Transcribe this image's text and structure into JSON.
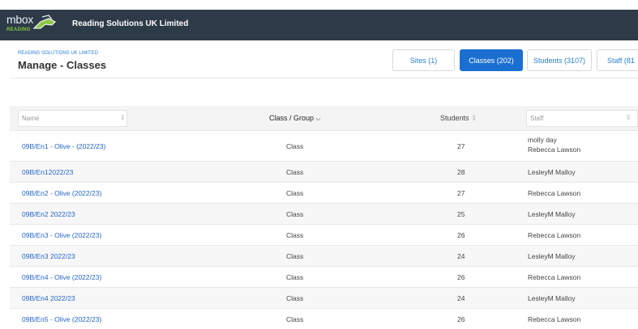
{
  "app": {
    "logo_text": "mbox",
    "logo_sub": "READING",
    "org_name": "Reading Solutions UK Limited"
  },
  "header": {
    "breadcrumb": "READING SOLUTIONS UK LIMITED",
    "title": "Manage - Classes"
  },
  "tabs": [
    {
      "label": "Sites (1)",
      "active": false
    },
    {
      "label": "Classes (202)",
      "active": true
    },
    {
      "label": "Students (3107)",
      "active": false
    },
    {
      "label": "Staff (81",
      "active": false
    }
  ],
  "table": {
    "columns": {
      "name_placeholder": "Name",
      "class_group_label": "Class / Group",
      "students_label": "Students",
      "staff_placeholder": "Staff"
    },
    "rows": [
      {
        "name": "09B/En1 - Olive - (2022/23)",
        "type": "Class",
        "students": "27",
        "staff": [
          "molly day",
          "Rebecca Lawson"
        ]
      },
      {
        "name": "09B/En12022/23",
        "type": "Class",
        "students": "28",
        "staff": [
          "LesleyM Malloy"
        ]
      },
      {
        "name": "09B/En2 - Olive (2022/23)",
        "type": "Class",
        "students": "27",
        "staff": [
          "Rebecca Lawson"
        ]
      },
      {
        "name": "09B/En2 2022/23",
        "type": "Class",
        "students": "25",
        "staff": [
          "LesleyM Malloy"
        ]
      },
      {
        "name": "09B/En3 - Olive (2022/23)",
        "type": "Class",
        "students": "26",
        "staff": [
          "Rebecca Lawson"
        ]
      },
      {
        "name": "09B/En3 2022/23",
        "type": "Class",
        "students": "24",
        "staff": [
          "LesleyM Malloy"
        ]
      },
      {
        "name": "09B/En4 - Olive (2022/23)",
        "type": "Class",
        "students": "26",
        "staff": [
          "Rebecca Lawson"
        ]
      },
      {
        "name": "09B/En4 2022/23",
        "type": "Class",
        "students": "24",
        "staff": [
          "LesleyM Malloy"
        ]
      },
      {
        "name": "09B/En5 - Olive (2022/23)",
        "type": "Class",
        "students": "26",
        "staff": [
          "Rebecca Lawson"
        ]
      }
    ]
  },
  "colors": {
    "topbar": "#2d3a47",
    "accent": "#1b6fd1",
    "link": "#2366c9"
  }
}
